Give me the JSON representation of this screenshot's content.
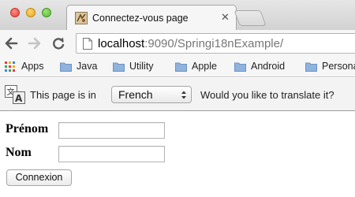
{
  "window": {
    "tab_title": "Connectez-vous page",
    "tab_close": "✕"
  },
  "toolbar": {
    "url_host": "localhost",
    "url_rest": ":9090/Springi18nExample/"
  },
  "bookmarks": {
    "items": [
      {
        "label": "Apps",
        "icon": "apps-grid-icon"
      },
      {
        "label": "Java",
        "icon": "folder-icon"
      },
      {
        "label": "Utility",
        "icon": "folder-icon"
      },
      {
        "label": "Apple",
        "icon": "folder-icon"
      },
      {
        "label": "Android",
        "icon": "folder-icon"
      },
      {
        "label": "Personal",
        "icon": "folder-icon"
      }
    ]
  },
  "translate_bar": {
    "prefix": "This page is in",
    "language": "French",
    "question": "Would you like to translate it?"
  },
  "form": {
    "first_name_label": "Prénom",
    "first_name_value": "",
    "last_name_label": "Nom",
    "last_name_value": "",
    "submit_label": "Connexion"
  },
  "colors": {
    "folder": "#8fb3dd",
    "folder_dark": "#6e93c2"
  }
}
